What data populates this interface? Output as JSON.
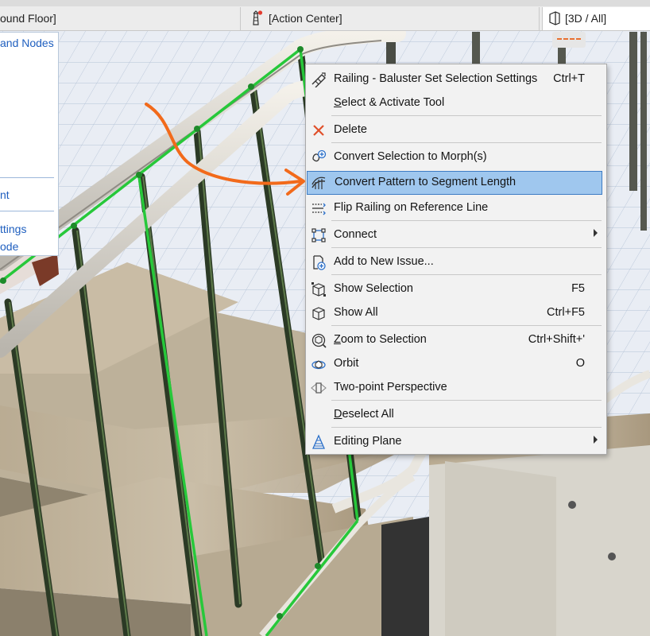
{
  "tabs": {
    "floor_label": "ound Floor]",
    "action_center_label": "[Action Center]",
    "view3d_label": "[3D / All]"
  },
  "left_panel": {
    "items": [
      "and Nodes",
      "nt",
      "ttings",
      "ode"
    ]
  },
  "context_menu": {
    "items": [
      {
        "label": "Railing - Baluster Set Selection Settings",
        "shortcut": "Ctrl+T",
        "icon": "railing-settings-icon"
      },
      {
        "label_u": "S",
        "label_rest": "elect & Activate Tool",
        "icon": ""
      },
      {
        "label": "Delete",
        "icon": "delete-x-icon"
      },
      {
        "label": "Convert Selection to Morph(s)",
        "icon": "morph-convert-icon"
      },
      {
        "label": "Convert Pattern to Segment Length",
        "icon": "pattern-segment-icon",
        "highlighted": true
      },
      {
        "label": "Flip Railing on Reference Line",
        "icon": "flip-railing-icon"
      },
      {
        "label": "Connect",
        "icon": "connect-icon",
        "submenu": true
      },
      {
        "label": "Add to New Issue...",
        "icon": "add-issue-icon"
      },
      {
        "label": "Show Selection",
        "shortcut": "F5",
        "icon": "show-selection-icon"
      },
      {
        "label": "Show All",
        "shortcut": "Ctrl+F5",
        "icon": "show-all-icon"
      },
      {
        "label_u": "Z",
        "label_rest": "oom to Selection",
        "shortcut": "Ctrl+Shift+'",
        "icon": "zoom-selection-icon"
      },
      {
        "label": "Orbit",
        "shortcut": "O",
        "icon": "orbit-icon"
      },
      {
        "label": "Two-point Perspective",
        "icon": "two-point-perspective-icon"
      },
      {
        "label_u": "D",
        "label_rest": "eselect All",
        "icon": ""
      },
      {
        "label": "Editing Plane",
        "icon": "editing-plane-icon",
        "submenu": true
      }
    ]
  },
  "colors": {
    "highlight": "#9fc7ee",
    "highlight_border": "#3d7cc4",
    "annotation_arrow": "#f26a1b",
    "selection_green": "#27c83a",
    "delete_red": "#e0502a"
  }
}
